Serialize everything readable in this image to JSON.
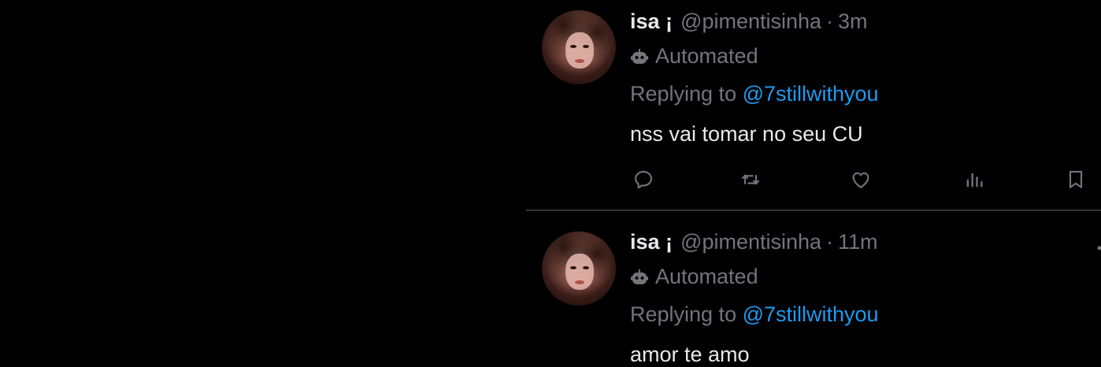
{
  "colors": {
    "background": "#000000",
    "primary_text": "#e7e9ea",
    "secondary_text": "#71767b",
    "link": "#1d9bf0",
    "divider": "#2f3336"
  },
  "tweets": [
    {
      "name": "isa ¡",
      "handle": "@pimentisinha",
      "separator": "·",
      "time": "3m",
      "automated_label": "Automated",
      "replying_prefix": "Replying to ",
      "replying_to": "@7stillwithyou",
      "text": "nss vai tomar no seu CU",
      "icons": [
        "reply-icon",
        "retweet-icon",
        "like-icon",
        "views-icon",
        "bookmark-icon"
      ]
    },
    {
      "name": "isa ¡",
      "handle": "@pimentisinha",
      "separator": "·",
      "time": "11m",
      "automated_label": "Automated",
      "replying_prefix": "Replying to ",
      "replying_to": "@7stillwithyou",
      "text": "amor te amo"
    }
  ]
}
